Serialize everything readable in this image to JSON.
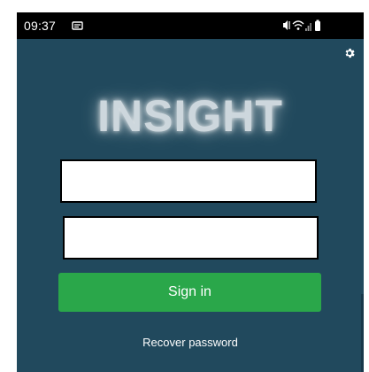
{
  "status_bar": {
    "time": "09:37",
    "icons": [
      "notification-icon",
      "mute-icon",
      "wifi-icon",
      "signal-icon",
      "battery-icon"
    ]
  },
  "header": {
    "settings_icon": "gear-icon"
  },
  "logo": {
    "text": "INSIGHT"
  },
  "login_form": {
    "username": {
      "value": "",
      "placeholder": ""
    },
    "password": {
      "value": "",
      "placeholder": ""
    },
    "signin_label": "Sign in",
    "recover_label": "Recover password"
  },
  "colors": {
    "background": "#21495d",
    "status_bar": "#000000",
    "button": "#2aa74a",
    "text": "#ffffff"
  }
}
